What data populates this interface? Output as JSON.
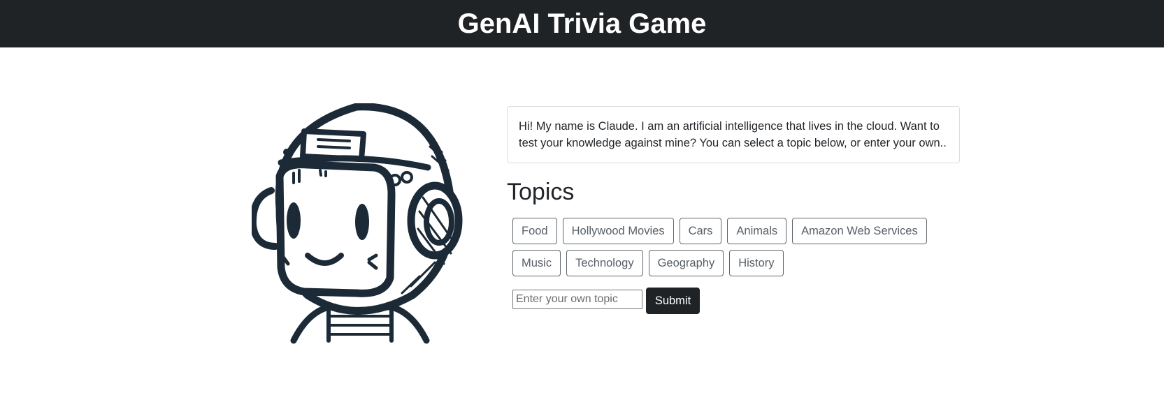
{
  "header": {
    "title": "GenAI Trivia Game"
  },
  "intro": {
    "message": "Hi! My name is Claude. I am an artificial intelligence that lives in the cloud. Want to test your knowledge against mine? You can select a topic below, or enter your own.."
  },
  "topics": {
    "heading": "Topics",
    "row1": [
      "Food",
      "Hollywood Movies",
      "Cars",
      "Animals",
      "Amazon Web Services"
    ],
    "row2": [
      "Music",
      "Technology",
      "Geography",
      "History"
    ]
  },
  "custom_topic": {
    "placeholder": "Enter your own topic",
    "value": "",
    "submit_label": "Submit"
  },
  "colors": {
    "header_bg": "#1f2326",
    "mascot_ink": "#1b2a36",
    "button_border": "#5f666c"
  },
  "icons": {
    "mascot": "robot-astronaut-mascot-icon"
  }
}
